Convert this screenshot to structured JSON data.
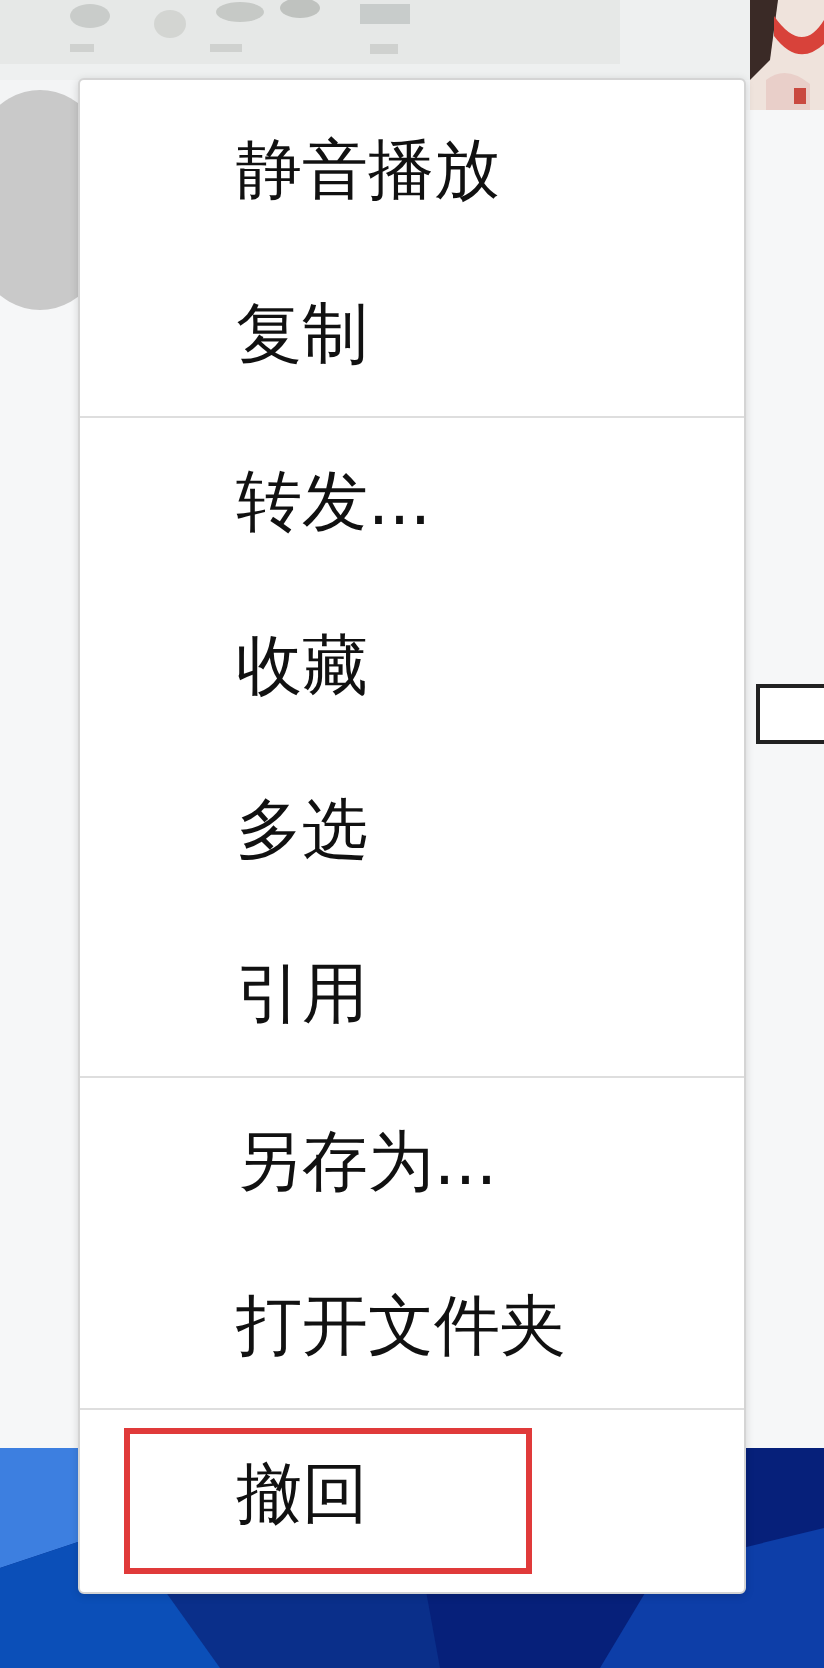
{
  "menu": {
    "groups": [
      {
        "items": [
          {
            "label": "静音播放",
            "highlighted": false
          },
          {
            "label": "复制",
            "highlighted": false
          }
        ]
      },
      {
        "items": [
          {
            "label": "转发...",
            "highlighted": false
          },
          {
            "label": "收藏",
            "highlighted": false
          },
          {
            "label": "多选",
            "highlighted": false
          },
          {
            "label": "引用",
            "highlighted": false
          }
        ]
      },
      {
        "items": [
          {
            "label": "另存为...",
            "highlighted": false
          },
          {
            "label": "打开文件夹",
            "highlighted": false
          }
        ]
      },
      {
        "items": [
          {
            "label": "撤回",
            "highlighted": true
          }
        ]
      }
    ]
  }
}
